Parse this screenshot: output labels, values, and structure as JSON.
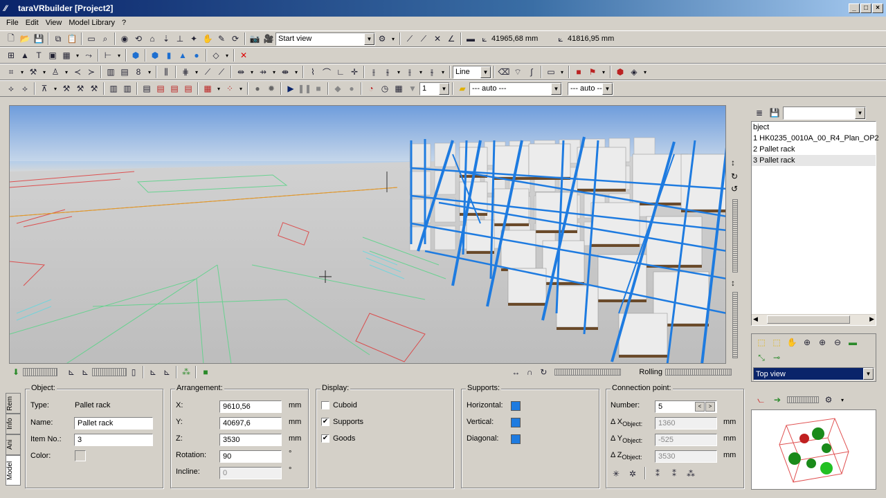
{
  "window": {
    "title": "taraVRbuilder [Project2]"
  },
  "menu": [
    "File",
    "Edit",
    "View",
    "Model Library",
    "?"
  ],
  "toolbar": {
    "view_select": "Start view",
    "coord_x": "41965,68 mm",
    "coord_y": "41816,95 mm",
    "line_type": "Line",
    "frame_value": "1",
    "auto1": "--- auto ---",
    "auto2": "--- auto ---"
  },
  "viewport_toolbar": {
    "rolling_label": "Rolling"
  },
  "tree": {
    "header": "bject",
    "items": [
      {
        "label": "1  HK0235_0010A_00_R4_Plan_OP2"
      },
      {
        "label": "2  Pallet rack"
      },
      {
        "label": "3  Pallet rack"
      }
    ]
  },
  "nav_panel": {
    "view_select": "Top view"
  },
  "side_tabs": [
    "Rem",
    "Info",
    "Ani",
    "Model"
  ],
  "object": {
    "title": "Object:",
    "type_label": "Type:",
    "type_value": "Pallet rack",
    "name_label": "Name:",
    "name_value": "Pallet rack",
    "item_label": "Item No.:",
    "item_value": "3",
    "color_label": "Color:"
  },
  "arrangement": {
    "title": "Arrangement:",
    "x_label": "X:",
    "x_value": "9610,56",
    "y_label": "Y:",
    "y_value": "40697,6",
    "z_label": "Z:",
    "z_value": "3530",
    "rotation_label": "Rotation:",
    "rotation_value": "90",
    "incline_label": "Incline:",
    "incline_value": "0",
    "unit_mm": "mm",
    "unit_deg": "°"
  },
  "display": {
    "title": "Display:",
    "cuboid": "Cuboid",
    "supports": "Supports",
    "goods": "Goods",
    "cuboid_checked": false,
    "supports_checked": true,
    "goods_checked": true
  },
  "supports": {
    "title": "Supports:",
    "horizontal": "Horizontal:",
    "vertical": "Vertical:",
    "diagonal": "Diagonal:",
    "color": "#1e7be0"
  },
  "connection": {
    "title": "Connection point:",
    "number_label": "Number:",
    "number_value": "5",
    "dx_label": "Object:",
    "dx_value": "1360",
    "dy_value": "-525",
    "dz_value": "3530",
    "unit": "mm"
  }
}
